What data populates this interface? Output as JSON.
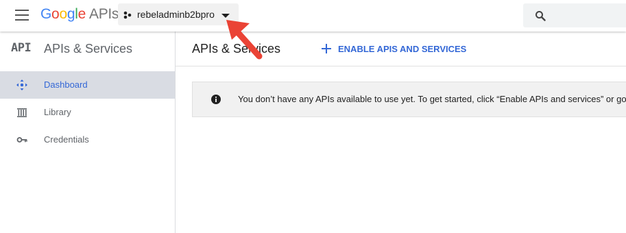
{
  "header": {
    "logo_google": [
      "G",
      "o",
      "o",
      "g",
      "l",
      "e"
    ],
    "logo_apis": "APIs",
    "project_name": "rebeladminb2bpro"
  },
  "sidebar": {
    "badge": "API",
    "title": "APIs & Services",
    "items": [
      {
        "label": "Dashboard",
        "icon": "dashboard-icon",
        "active": true
      },
      {
        "label": "Library",
        "icon": "library-icon",
        "active": false
      },
      {
        "label": "Credentials",
        "icon": "key-icon",
        "active": false
      }
    ]
  },
  "main": {
    "title": "APIs & Services",
    "enable_label": "ENABLE APIS AND SERVICES",
    "info_message": "You don’t have any APIs available to use yet. To get started, click “Enable APIs and services” or go t"
  },
  "colors": {
    "accent": "#3367d6",
    "annotation_arrow": "#ea4335",
    "active_nav_bg": "#d9dce3"
  }
}
